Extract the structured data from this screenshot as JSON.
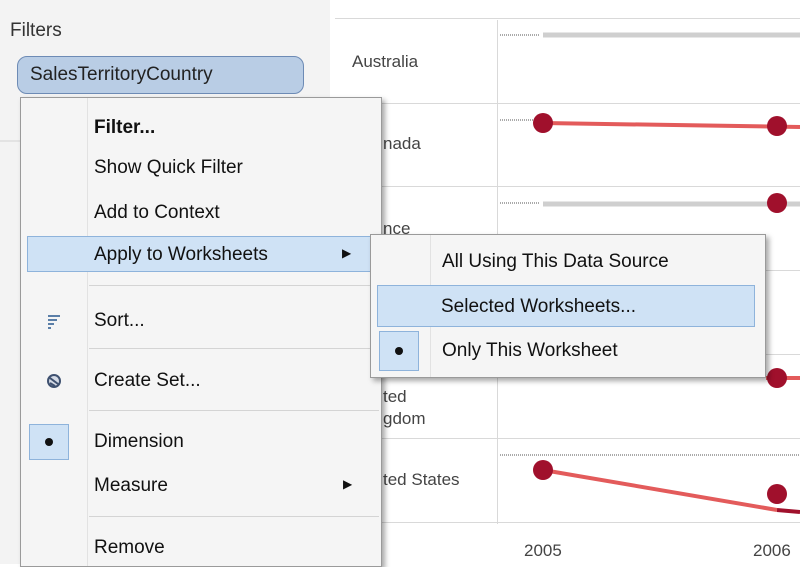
{
  "filters": {
    "title": "Filters",
    "pill": "SalesTerritoryCountry"
  },
  "view": {
    "rows": [
      "Australia",
      "nada",
      "nce",
      "ted",
      "gdom",
      "ted States"
    ],
    "x_ticks": [
      "2005",
      "2006"
    ],
    "mark_color": "#a0102c",
    "line_color": "#e35b5b"
  },
  "menu": {
    "items": [
      {
        "label": "Filter...",
        "bold": true
      },
      {
        "label": "Show Quick Filter"
      },
      {
        "label": "Add to Context"
      },
      {
        "label": "Apply to Worksheets",
        "submenu": true,
        "highlighted": true
      },
      {
        "label": "Sort...",
        "icon": "sort-icon"
      },
      {
        "label": "Create Set...",
        "icon": "set-icon"
      },
      {
        "label": "Dimension",
        "checked": true
      },
      {
        "label": "Measure",
        "submenu": true
      },
      {
        "label": "Remove"
      }
    ],
    "arrow": "▶"
  },
  "submenu": {
    "items": [
      {
        "label": "All Using This Data Source"
      },
      {
        "label": "Selected Worksheets...",
        "highlighted": true
      },
      {
        "label": "Only This Worksheet",
        "checked": true
      }
    ]
  }
}
